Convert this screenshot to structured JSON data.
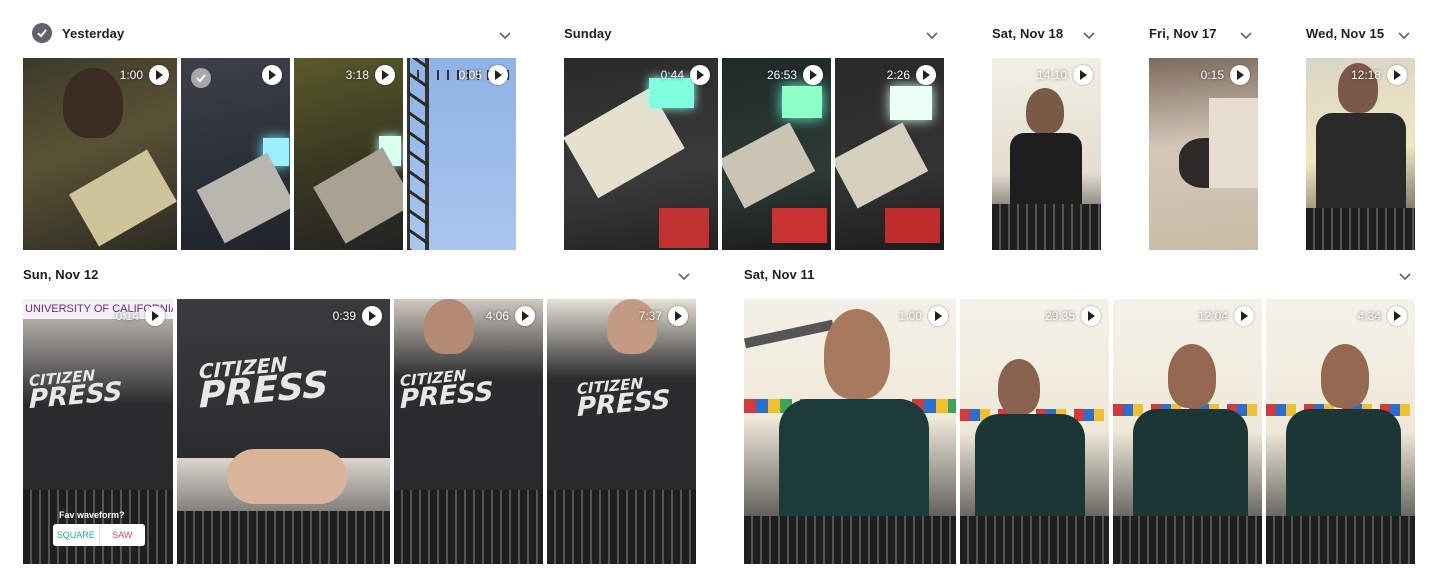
{
  "groups": {
    "yesterday": {
      "title": "Yesterday",
      "durations": [
        "1:00",
        "3:18",
        "0:05"
      ]
    },
    "sunday": {
      "title": "Sunday",
      "durations": [
        "0:44",
        "26:53",
        "2:26"
      ]
    },
    "sat_nov18": {
      "title": "Sat, Nov 18",
      "durations": [
        "14:10"
      ]
    },
    "fri_nov17": {
      "title": "Fri, Nov 17",
      "durations": [
        "0:15"
      ]
    },
    "wed_nov15": {
      "title": "Wed, Nov 15",
      "durations": [
        "12:18"
      ]
    },
    "sun_nov12": {
      "title": "Sun, Nov 12",
      "durations": [
        "0:14",
        "0:39",
        "4:06",
        "7:37"
      ]
    },
    "sat_nov11": {
      "title": "Sat, Nov 11",
      "durations": [
        "1:00",
        "29:35",
        "12:04",
        "4:34"
      ]
    }
  },
  "overlays": {
    "banner": "UNIVERSITY OF CALIFORNIA, IRV",
    "shirt_line1": "CITIZEN",
    "shirt_line2": "PRESS",
    "poll_question": "Fav waveform?",
    "poll_option_a": "SQUARE",
    "poll_option_b": "SAW"
  },
  "icons": {
    "select": "check-circle-icon",
    "collapse": "chevron-down-icon",
    "play": "play-icon"
  },
  "colors": {
    "header_text": "#202124",
    "icon_gray": "#5f6368",
    "background": "#ffffff"
  }
}
